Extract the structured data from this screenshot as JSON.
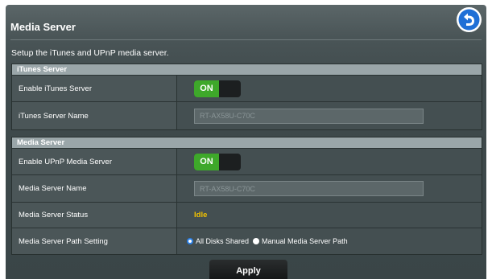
{
  "page": {
    "title": "Media Server",
    "description": "Setup the iTunes and UPnP media server."
  },
  "itunes": {
    "header": "iTunes Server",
    "enable_label": "Enable iTunes Server",
    "enable_state": "ON",
    "name_label": "iTunes Server Name",
    "name_value": "RT-AX58U-C70C"
  },
  "media": {
    "header": "Media Server",
    "enable_label": "Enable UPnP Media Server",
    "enable_state": "ON",
    "name_label": "Media Server Name",
    "name_value": "RT-AX58U-C70C",
    "status_label": "Media Server Status",
    "status_value": "Idle",
    "path_label": "Media Server Path Setting",
    "path_options": [
      "All Disks Shared",
      "Manual Media Server Path"
    ],
    "path_selected": "All Disks Shared"
  },
  "actions": {
    "apply_label": "Apply"
  },
  "icons": {
    "back": "back-arrow-icon"
  },
  "colors": {
    "toggle_on": "#3ea82a",
    "status": "#f2c200",
    "radio_selected": "#2a7fe6"
  }
}
